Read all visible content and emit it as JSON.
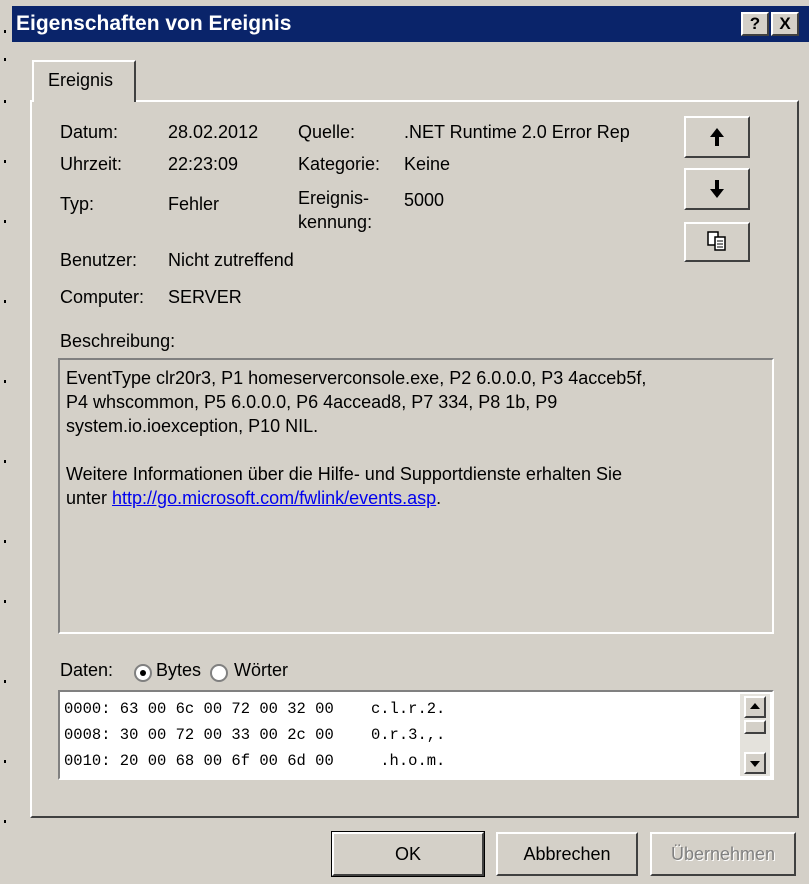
{
  "window": {
    "title": "Eigenschaften von Ereignis",
    "help_label": "?",
    "close_label": "X"
  },
  "tabs": [
    {
      "label": "Ereignis"
    }
  ],
  "fields": {
    "date_label": "Datum:",
    "date_value": "28.02.2012",
    "time_label": "Uhrzeit:",
    "time_value": "22:23:09",
    "type_label": "Typ:",
    "type_value": "Fehler",
    "user_label": "Benutzer:",
    "user_value": "Nicht zutreffend",
    "computer_label": "Computer:",
    "computer_value": "SERVER",
    "source_label": "Quelle:",
    "source_value": ".NET Runtime 2.0 Error Rep",
    "category_label": "Kategorie:",
    "category_value": "Keine",
    "event_id_label_line1": "Ereignis-",
    "event_id_label_line2": "kennung:",
    "event_id_value": "5000"
  },
  "nav_buttons": {
    "up_icon": "arrow-up-icon",
    "down_icon": "arrow-down-icon",
    "copy_icon": "copy-icon"
  },
  "description": {
    "label": "Beschreibung:",
    "line1": "EventType clr20r3, P1 homeserverconsole.exe, P2 6.0.0.0, P3 4acceb5f,",
    "line2": "P4 whscommon, P5 6.0.0.0, P6 4accead8, P7 334, P8 1b, P9",
    "line3": "system.io.ioexception, P10 NIL.",
    "para2_line1": "Weitere Informationen über die Hilfe- und Supportdienste erhalten Sie",
    "para2_prefix": "unter ",
    "link": "http://go.microsoft.com/fwlink/events.asp",
    "para2_suffix": "."
  },
  "data_section": {
    "label": "Daten:",
    "options": [
      {
        "label": "Bytes",
        "selected": true
      },
      {
        "label": "Wörter",
        "selected": false
      }
    ],
    "rows": [
      "0000: 63 00 6c 00 72 00 32 00    c.l.r.2.",
      "0008: 30 00 72 00 33 00 2c 00    0.r.3.,.",
      "0010: 20 00 68 00 6f 00 6d 00     .h.o.m."
    ]
  },
  "buttons": {
    "ok": "OK",
    "cancel": "Abbrechen",
    "apply": "Übernehmen"
  }
}
